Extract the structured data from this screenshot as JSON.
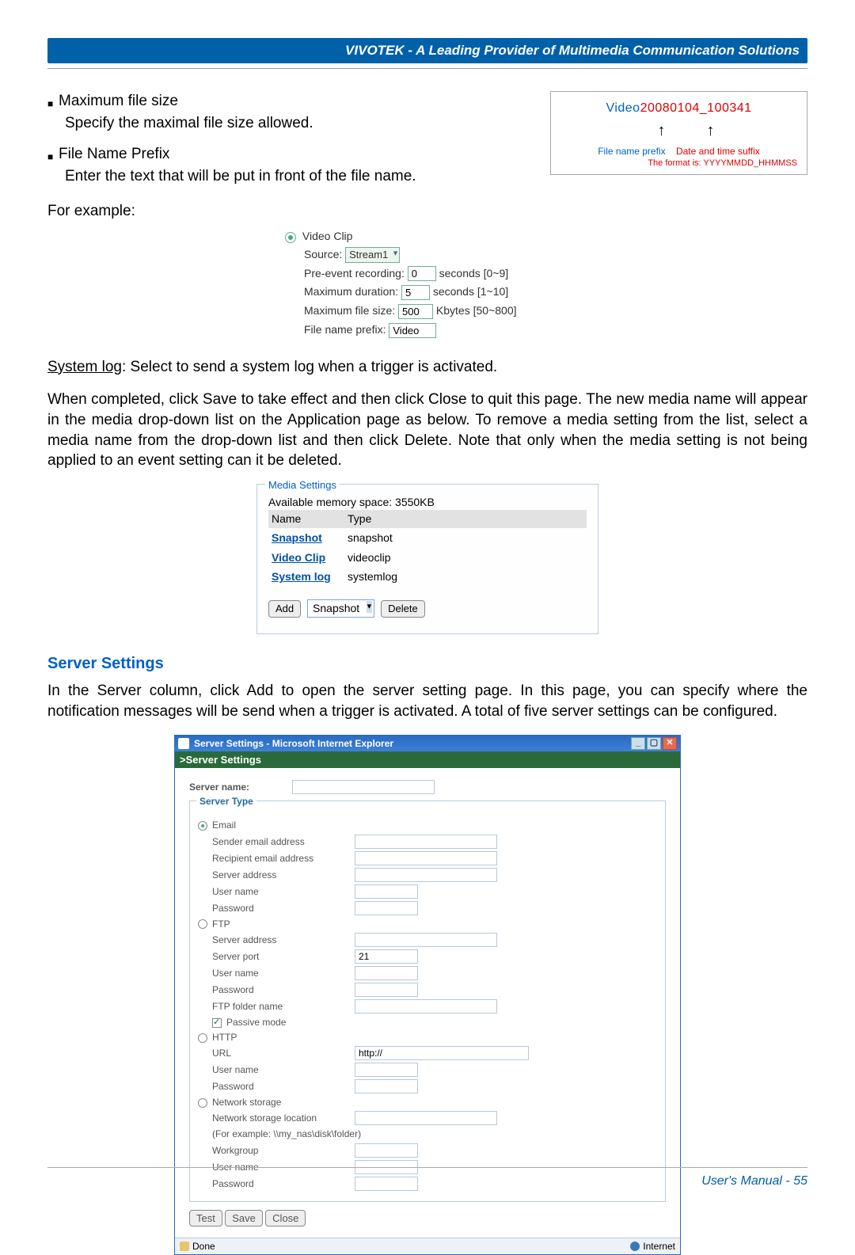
{
  "header": {
    "title": "VIVOTEK - A Leading Provider of Multimedia Communication Solutions"
  },
  "bullets": {
    "max_size_title": "Maximum file size",
    "max_size_desc": "Specify the maximal file size allowed.",
    "prefix_title": "File Name Prefix",
    "prefix_desc": "Enter the text that will be put in front of the file name."
  },
  "example_label": "For example:",
  "diagram": {
    "prefix_text": "Video",
    "suffix_text": "20080104_100341",
    "lbl_prefix": "File name prefix",
    "lbl_suffix": "Date and time suffix",
    "lbl_format": "The format is: YYYYMMDD_HHMMSS"
  },
  "video_clip": {
    "title": "Video Clip",
    "source_lbl": "Source:",
    "source_val": "Stream1",
    "pre_lbl": "Pre-event recording:",
    "pre_val": "0",
    "pre_unit": "seconds [0~9]",
    "dur_lbl": "Maximum duration:",
    "dur_val": "5",
    "dur_unit": "seconds [1~10]",
    "size_lbl": "Maximum file size:",
    "size_val": "500",
    "size_unit": "Kbytes [50~800]",
    "prefix_lbl": "File name prefix:",
    "prefix_val": "Video"
  },
  "syslog_para": {
    "lead": "System log",
    "rest": ": Select to send a system log when a trigger is activated."
  },
  "completion_para": "When completed, click Save to take effect and then click Close to quit this page. The new media name will appear in the media drop-down list on the Application page as below. To remove a media setting from the list, select a media name from the drop-down list and then click Delete. Note that only when the media setting is not being applied to an event setting can it be deleted.",
  "media_settings": {
    "title": "Media Settings",
    "avail": "Available memory space: 3550KB",
    "col_name": "Name",
    "col_type": "Type",
    "rows": [
      {
        "name": "Snapshot",
        "type": "snapshot"
      },
      {
        "name": "Video Clip",
        "type": "videoclip"
      },
      {
        "name": "System log",
        "type": "systemlog"
      }
    ],
    "add_btn": "Add",
    "sel_val": "Snapshot",
    "del_btn": "Delete"
  },
  "server_section": {
    "title": "Server Settings",
    "intro": "In the Server column, click Add to open the server setting page. In this page, you can specify where the notification messages will be send when a trigger is activated. A total of five server settings can be configured."
  },
  "ie_window": {
    "title": "Server Settings - Microsoft Internet Explorer",
    "header": ">Server Settings",
    "server_name_lbl": "Server name:",
    "server_type_title": "Server Type",
    "email": {
      "lbl": "Email",
      "sender": "Sender email address",
      "recipient": "Recipient email address",
      "server": "Server address",
      "user": "User name",
      "pass": "Password"
    },
    "ftp": {
      "lbl": "FTP",
      "server": "Server address",
      "port_lbl": "Server port",
      "port_val": "21",
      "user": "User name",
      "pass": "Password",
      "folder": "FTP folder name",
      "passive": "Passive mode"
    },
    "http": {
      "lbl": "HTTP",
      "url_lbl": "URL",
      "url_val": "http://",
      "user": "User name",
      "pass": "Password"
    },
    "ns": {
      "lbl": "Network storage",
      "loc": "Network storage location",
      "eg": "(For example: \\\\my_nas\\disk\\folder)",
      "wg": "Workgroup",
      "user": "User name",
      "pass": "Password"
    },
    "btn_test": "Test",
    "btn_save": "Save",
    "btn_close": "Close",
    "status_done": "Done",
    "status_zone": "Internet"
  },
  "footer": {
    "text": "User's Manual - 55"
  }
}
